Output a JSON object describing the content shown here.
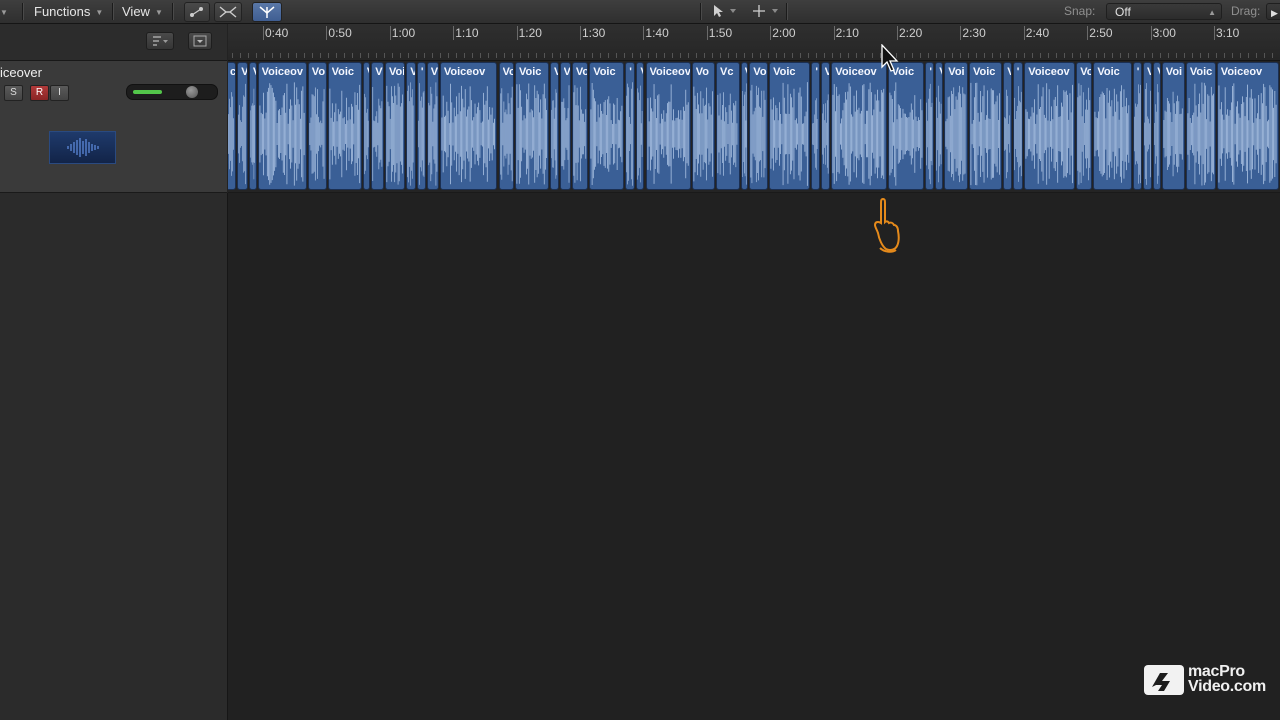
{
  "toolbar": {
    "functions_label": "Functions",
    "view_label": "View",
    "snap_label": "Snap:",
    "snap_value": "Off",
    "drag_label": "Drag:"
  },
  "track": {
    "name": "iceover",
    "solo_label": "S",
    "record_label": "R",
    "input_label": "I",
    "volume_level": 0.72
  },
  "ruler": {
    "ticks": [
      "0:40",
      "0:50",
      "1:00",
      "1:10",
      "1:20",
      "1:30",
      "1:40",
      "1:50",
      "2:00",
      "2:10",
      "2:20",
      "2:30",
      "2:40",
      "2:50",
      "3:00",
      "3:10"
    ]
  },
  "regions": [
    {
      "label": "c"
    },
    {
      "label": "V"
    },
    {
      "label": "V"
    },
    {
      "label": "Voiceov"
    },
    {
      "label": "Vo"
    },
    {
      "label": "Voic"
    },
    {
      "label": "V"
    },
    {
      "label": "V"
    },
    {
      "label": "Voi"
    },
    {
      "label": "V"
    },
    {
      "label": "'"
    },
    {
      "label": "V"
    },
    {
      "label": "Voiceov"
    },
    {
      "label": "Voi"
    },
    {
      "label": "Voic"
    },
    {
      "label": "V"
    },
    {
      "label": "V"
    },
    {
      "label": "Voi"
    },
    {
      "label": "Voic"
    },
    {
      "label": "'"
    },
    {
      "label": "V"
    },
    {
      "label": "Voiceov"
    },
    {
      "label": "Vo"
    },
    {
      "label": "Vc"
    },
    {
      "label": "V"
    },
    {
      "label": "Voi"
    },
    {
      "label": "Voic"
    },
    {
      "label": "'"
    },
    {
      "label": "V"
    },
    {
      "label": "Voiceov"
    },
    {
      "label": "Voic"
    },
    {
      "label": "'"
    },
    {
      "label": "V"
    },
    {
      "label": "Voi"
    },
    {
      "label": "Voic"
    },
    {
      "label": "V"
    },
    {
      "label": "'"
    },
    {
      "label": "Voiceov"
    },
    {
      "label": "Vo"
    },
    {
      "label": "Voic"
    },
    {
      "label": "'"
    },
    {
      "label": "V"
    },
    {
      "label": "V"
    },
    {
      "label": "Voi"
    },
    {
      "label": "Voic"
    },
    {
      "label": "Voiceov"
    }
  ],
  "watermark": {
    "brand_line1": "macPro",
    "brand_line2": "Video.com"
  },
  "icons": {
    "pointer_tool": "arrow-icon",
    "marquee_tool": "crosshair-icon",
    "catch_tool": "catch-playhead-icon",
    "flex_tool": "flex-icon",
    "waveform": "waveform-icon"
  },
  "colors": {
    "region": "#3a5f96",
    "region_selected": "#6d93c8",
    "record_button": "#b03a3a",
    "volume_fill": "#53c64a",
    "hand_cursor": "#e58a1b"
  }
}
